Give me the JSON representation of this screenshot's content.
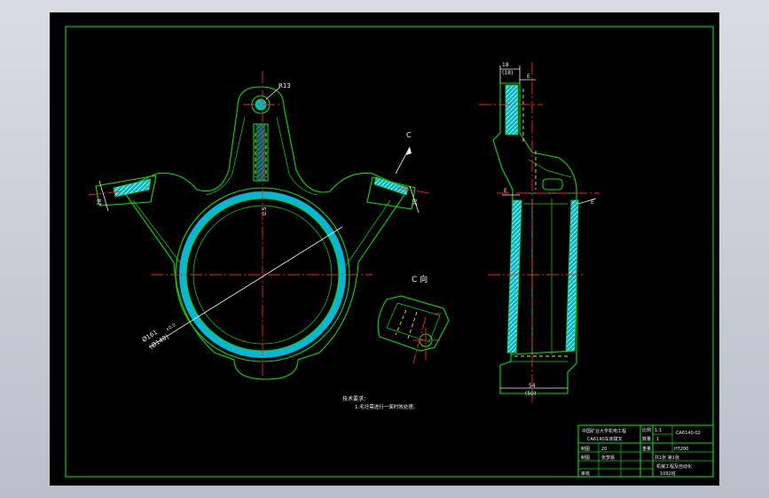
{
  "dimensions": {
    "boss_radius": "R13",
    "bore_dia_1": "Ø161",
    "bore_dia_2": "(Ø140)",
    "bore_tol": "+0.0",
    "center_offset": "0.5",
    "top_width": "18",
    "top_width_ref": "(18)",
    "bottom_width": "54",
    "bottom_width_ref": "(50)",
    "left_tab": "28",
    "right_tab": "28"
  },
  "labels": {
    "view_arrow": "C",
    "view_c_title": "C 向",
    "section_mark": "E"
  },
  "notes": {
    "heading": "技术要求：",
    "line1": "1.毛坯需进行一面时效处理。"
  },
  "title_block": {
    "school": "中国矿业大学机电工程",
    "part_name": "CA6140车床拨叉",
    "scale_label": "比例",
    "scale_value": "1:1",
    "qty_label": "数量",
    "qty_value": "1",
    "drawing_no": "CA6140-02",
    "weight_label": "重量",
    "material_label": "HT200",
    "sheet_value": "共1张 第1张",
    "draw_label": "制图",
    "check_label": "审核",
    "designer": "张梦晨",
    "drawn": "20",
    "class_name": "机械工程及自动化",
    "class_no": "1092班"
  },
  "colors": {
    "paper": "#000000",
    "outline": "#00e000",
    "center_line": "#ff2020",
    "hidden_line": "#e8e800",
    "hatch": "#00c8e0",
    "text": "#f0f0f0"
  }
}
